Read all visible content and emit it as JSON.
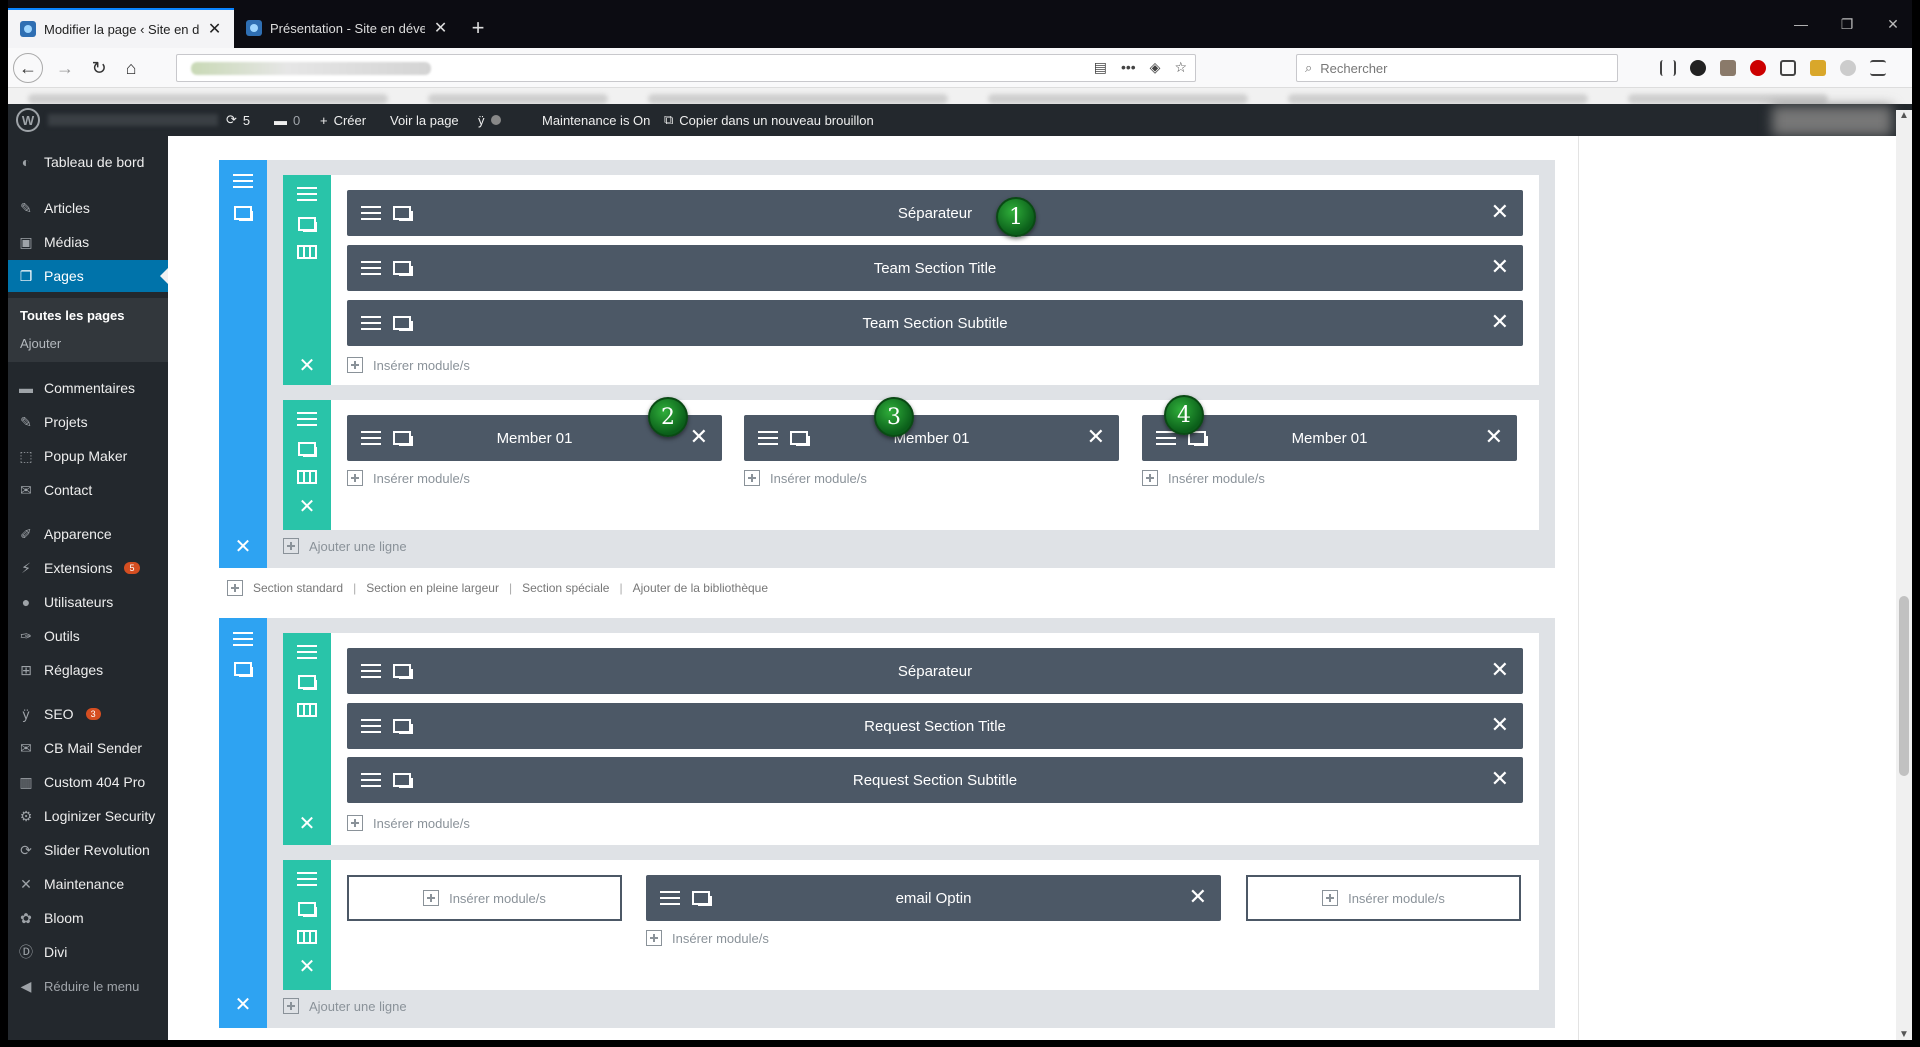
{
  "browser": {
    "tabs": [
      {
        "title": "Modifier la page ‹ Site en dével",
        "active": true
      },
      {
        "title": "Présentation - Site en développ",
        "active": false
      }
    ],
    "search_placeholder": "Rechercher"
  },
  "adminbar": {
    "updates": "5",
    "comments": "0",
    "create": "Créer",
    "view": "Voir la page",
    "maintenance": "Maintenance is On",
    "copy": "Copier dans un nouveau brouillon"
  },
  "sidebar": {
    "items": [
      {
        "label": "Tableau de bord",
        "icon": "dashboard-icon"
      },
      {
        "label": "Articles",
        "icon": "pin-icon"
      },
      {
        "label": "Médias",
        "icon": "media-icon"
      },
      {
        "label": "Pages",
        "icon": "page-icon"
      },
      {
        "label": "Commentaires",
        "icon": "comment-icon"
      },
      {
        "label": "Projets",
        "icon": "pin-icon"
      },
      {
        "label": "Popup Maker",
        "icon": "popup-icon"
      },
      {
        "label": "Contact",
        "icon": "mail-icon"
      },
      {
        "label": "Apparence",
        "icon": "brush-icon"
      },
      {
        "label": "Extensions",
        "icon": "plugin-icon",
        "badge": "5"
      },
      {
        "label": "Utilisateurs",
        "icon": "user-icon"
      },
      {
        "label": "Outils",
        "icon": "wrench-icon"
      },
      {
        "label": "Réglages",
        "icon": "settings-icon"
      },
      {
        "label": "SEO",
        "icon": "yoast-icon",
        "badge": "3"
      },
      {
        "label": "CB Mail Sender",
        "icon": "mail-icon"
      },
      {
        "label": "Custom 404 Pro",
        "icon": "chart-icon"
      },
      {
        "label": "Loginizer Security",
        "icon": "gear-icon"
      },
      {
        "label": "Slider Revolution",
        "icon": "refresh-icon"
      },
      {
        "label": "Maintenance",
        "icon": "tools-icon"
      },
      {
        "label": "Bloom",
        "icon": "bloom-icon"
      },
      {
        "label": "Divi",
        "icon": "divi-icon"
      },
      {
        "label": "Réduire le menu",
        "icon": "collapse-icon"
      }
    ],
    "submenu": [
      "Toutes les pages",
      "Ajouter"
    ]
  },
  "builder": {
    "insert_module": "Insérer module/s",
    "add_row": "Ajouter une ligne",
    "section1": {
      "row1_modules": [
        "Séparateur",
        "Team Section Title",
        "Team Section Subtitle"
      ],
      "row2_modules": [
        "Member 01",
        "Member 01",
        "Member 01"
      ]
    },
    "section_links": [
      "Section standard",
      "Section en pleine largeur",
      "Section spéciale",
      "Ajouter de la bibliothèque"
    ],
    "section2": {
      "row1_modules": [
        "Séparateur",
        "Request Section Title",
        "Request Section Subtitle"
      ],
      "row2_module": "email Optin"
    },
    "annotations": [
      "1",
      "2",
      "3",
      "4"
    ]
  }
}
